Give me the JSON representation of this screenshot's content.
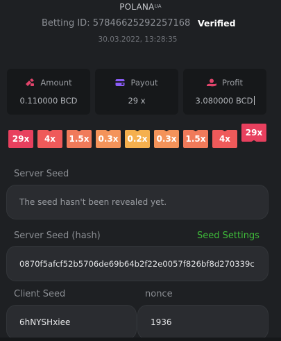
{
  "header": {
    "username": "POLANA",
    "username_sup": "UA",
    "betting_id_label": "Betting ID:",
    "betting_id": "57846625292257168",
    "verified_label": "Verified",
    "timestamp": "30.03.2022, 13:28:35"
  },
  "stats": {
    "amount": {
      "label": "Amount",
      "value": "0.110000 BCD",
      "icon": "coins-icon",
      "color": "#e0446b"
    },
    "payout": {
      "label": "Payout",
      "value": "29 x",
      "icon": "wallet-icon",
      "color": "#8a5cf6"
    },
    "profit": {
      "label": "Profit",
      "value": "3.080000 BCD",
      "icon": "hand-coins-icon",
      "color": "#e0446b"
    }
  },
  "multipliers": [
    {
      "label": "29x",
      "color": "#e8405e",
      "active": false
    },
    {
      "label": "4x",
      "color": "#ef5a5a",
      "active": false
    },
    {
      "label": "1.5x",
      "color": "#f07a5a",
      "active": false
    },
    {
      "label": "0.3x",
      "color": "#f4935a",
      "active": false
    },
    {
      "label": "0.2x",
      "color": "#f5b04e",
      "active": false
    },
    {
      "label": "0.3x",
      "color": "#f4935a",
      "active": false
    },
    {
      "label": "1.5x",
      "color": "#f07a5a",
      "active": false
    },
    {
      "label": "4x",
      "color": "#ef5a5a",
      "active": false
    },
    {
      "label": "29x",
      "color": "#e8405e",
      "active": true
    }
  ],
  "server_seed": {
    "label": "Server Seed",
    "value": "The seed hasn't been revealed yet."
  },
  "server_seed_hash": {
    "label": "Server Seed (hash)",
    "settings_link": "Seed Settings",
    "value": "0870f5afcf52b5706de69b64b2f22e0057f826bf8d270339c"
  },
  "client_seed": {
    "label": "Client Seed",
    "value": "6hNYSHxiee"
  },
  "nonce": {
    "label": "nonce",
    "value": "1936"
  }
}
